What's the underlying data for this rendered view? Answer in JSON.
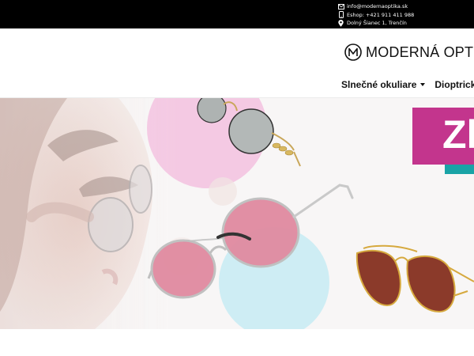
{
  "contact": {
    "email": "info@modernaoptika.sk",
    "phone": "Eshop: +421 911 411 988",
    "address": "Dolný Šianec 1, Trenčín",
    "icons": [
      "envelope-icon",
      "phone-icon",
      "map-pin-icon"
    ]
  },
  "logo": {
    "text": "MODERNÁ OPTIKA"
  },
  "nav": {
    "items": [
      {
        "label": "Slnečné okuliare",
        "has_dropdown": true
      },
      {
        "label": "Dioptrické o"
      }
    ]
  },
  "banner": {
    "promo_text": "Zľ",
    "colors": {
      "promo": "#c3358d",
      "accent": "#1aa3a6",
      "pink_circle": "#f3b9dc",
      "blue_circle": "#c9ecf4",
      "lens_pink": "#e08aa0",
      "lens_brown": "#8b3a2a"
    }
  }
}
